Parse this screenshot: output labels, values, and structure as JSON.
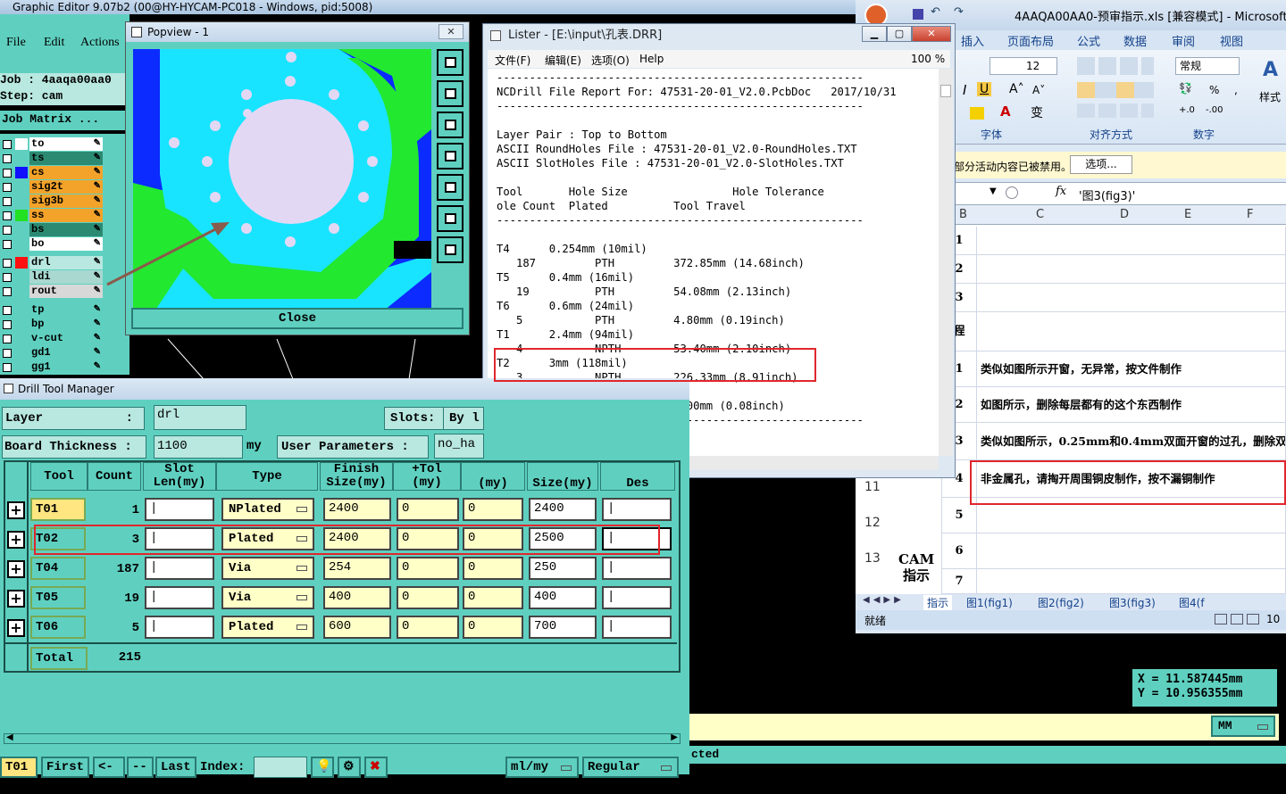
{
  "genesis": {
    "title": "Graphic Editor 9.07b2 (00@HY-HYCAM-PC018 - Windows, pid:5008)",
    "menu": [
      "File",
      "Edit",
      "Actions"
    ],
    "job_label": "Job : 4aaqa00aa0",
    "step_label": "Step: cam",
    "job_matrix": "Job Matrix ...",
    "layers": [
      {
        "name": "to",
        "color": "#ffffff",
        "row_bg": "#ffffff"
      },
      {
        "name": "ts",
        "color": "#5fd0c0",
        "row_bg": "#2c8a72"
      },
      {
        "name": "cs",
        "color": "#1010ff",
        "row_bg": "#f4a32a"
      },
      {
        "name": "sig2t",
        "color": "#5fd0c0",
        "row_bg": "#f4a32a"
      },
      {
        "name": "sig3b",
        "color": "#5fd0c0",
        "row_bg": "#f4a32a"
      },
      {
        "name": "ss",
        "color": "#22e022",
        "row_bg": "#f4a32a"
      },
      {
        "name": "bs",
        "color": "#5fd0c0",
        "row_bg": "#2c8a72"
      },
      {
        "name": "bo",
        "color": "#5fd0c0",
        "row_bg": "#ffffff"
      },
      {
        "name": "drl",
        "color": "#ff1010",
        "row_bg": "#b8e8e0"
      },
      {
        "name": "ldi",
        "color": "#5fd0c0",
        "row_bg": "#a8d8d0"
      },
      {
        "name": "rout",
        "color": "#5fd0c0",
        "row_bg": "#d8d8d8"
      },
      {
        "name": "tp",
        "color": "#5fd0c0",
        "row_bg": "#5fd0c0"
      },
      {
        "name": "bp",
        "color": "#5fd0c0",
        "row_bg": "#5fd0c0"
      },
      {
        "name": "v-cut",
        "color": "#5fd0c0",
        "row_bg": "#5fd0c0"
      },
      {
        "name": "gd1",
        "color": "#5fd0c0",
        "row_bg": "#5fd0c0"
      },
      {
        "name": "gg1",
        "color": "#5fd0c0",
        "row_bg": "#5fd0c0"
      }
    ],
    "coords": {
      "x": "X = 11.587445mm",
      "y": "Y = 10.956355mm"
    },
    "units": "MM",
    "status_text": "cted"
  },
  "popview": {
    "title": "Popview - 1",
    "close_label": "Close"
  },
  "lister": {
    "title": "Lister - [E:\\input\\孔表.DRR]",
    "menu": [
      "文件(F)",
      "编辑(E)",
      "选项(O)",
      "Help"
    ],
    "zoom": "100 %",
    "report": "--------------------------------------------------------\nNCDrill File Report For: 47531-20-01_V2.0.PcbDoc   2017/10/31\n--------------------------------------------------------\n\nLayer Pair : Top to Bottom\nASCII RoundHoles File : 47531-20-01_V2.0-RoundHoles.TXT\nASCII SlotHoles File : 47531-20-01_V2.0-SlotHoles.TXT\n\nTool       Hole Size                Hole Tolerance\nole Count  Plated          Tool Travel\n--------------------------------------------------------\n\nT4      0.254mm (10mil)\n   187         PTH         372.85mm (14.68inch)\nT5      0.4mm (16mil)\n   19          PTH         54.08mm (2.13inch)\nT6      0.6mm (24mil)\n   5           PTH         4.80mm (0.19inch)\nT1      2.4mm (94mil)\n   4           NPTH        53.40mm (2.10inch)\nT2      3mm (118mil)\n   3           NPTH        226.33mm (8.91inch)\nT3      3mm (118mil)\n   1           NPTH        2.00mm (0.08inch)\n--------------------------------------------------------"
  },
  "excel": {
    "title": "4AAQA00AA0-预审指示.xls [兼容模式] - Microsoft Excel",
    "tabs": [
      "插入",
      "页面布局",
      "公式",
      "数据",
      "审阅",
      "视图"
    ],
    "font_size": "12",
    "number_format": "常规",
    "style_label": "样式",
    "group_labels": [
      "字体",
      "对齐方式",
      "数字"
    ],
    "message": "部分活动内容已被禁用。",
    "options_button": "选项...",
    "formula": "'图3(fig3)'",
    "columns": [
      "B",
      "C",
      "D",
      "E",
      "F"
    ],
    "rows": [
      {
        "row": "1",
        "num": "1",
        "text": ""
      },
      {
        "row": "2",
        "num": "2",
        "text": ""
      },
      {
        "row": "3",
        "num": "3",
        "text": ""
      },
      {
        "row": "",
        "num": "程",
        "text": ""
      },
      {
        "row": "",
        "num": "1",
        "text": "类似如图所示开窗，无异常，按文件制作"
      },
      {
        "row": "",
        "num": "2",
        "text": "如图所示，删除每层都有的这个东西制作"
      },
      {
        "row": "",
        "num": "3",
        "text": "类似如图所示，0.25mm和0.4mm双面开窗的过孔，删除双"
      },
      {
        "row": "11",
        "num": "4",
        "text": "非金属孔，请掏开周围铜皮制作，按不漏铜制作"
      },
      {
        "row": "12",
        "num": "5",
        "text": ""
      },
      {
        "row": "13",
        "num": "6",
        "text": ""
      },
      {
        "row": "",
        "num": "7",
        "text": ""
      }
    ],
    "cam_label": "CAM\n指示",
    "sheets": [
      "指示",
      "图1(fig1)",
      "图2(fig2)",
      "图3(fig3)",
      "图4(f"
    ],
    "status": "就绪",
    "zoom": "10"
  },
  "dtm": {
    "title": "Drill Tool Manager",
    "layer_label": "Layer",
    "layer_value": "drl",
    "slots_label": "Slots:",
    "slots_value": "By l",
    "thickness_label": "Board Thickness :",
    "thickness_value": "1100",
    "thickness_unit": "my",
    "user_params_label": "User Parameters :",
    "user_params_value": "no_ha",
    "headers": [
      "Tool",
      "Count",
      "Slot\nLen(my)",
      "Type",
      "Finish\nSize(my)",
      "+Tol\n(my)",
      "(my)",
      "Size(my)",
      "Des"
    ],
    "rows": [
      {
        "tool": "T01",
        "count": "1",
        "type": "NPlated",
        "finish": "2400",
        "ptol": "0",
        "ntol": "0",
        "size": "2400",
        "highlight": true
      },
      {
        "tool": "T02",
        "count": "3",
        "type": "Plated",
        "finish": "2400",
        "ptol": "0",
        "ntol": "0",
        "size": "2500",
        "highlight": false
      },
      {
        "tool": "T04",
        "count": "187",
        "type": "Via",
        "finish": "254",
        "ptol": "0",
        "ntol": "0",
        "size": "250",
        "highlight": false
      },
      {
        "tool": "T05",
        "count": "19",
        "type": "Via",
        "finish": "400",
        "ptol": "0",
        "ntol": "0",
        "size": "400",
        "highlight": false
      },
      {
        "tool": "T06",
        "count": "5",
        "type": "Plated",
        "finish": "600",
        "ptol": "0",
        "ntol": "0",
        "size": "700",
        "highlight": false
      }
    ],
    "total_label": "Total",
    "total_value": "215",
    "nav": {
      "tool": "T01",
      "first": "First",
      "prev": "<--",
      "next": "-->",
      "last": "Last",
      "index": "Index:",
      "units": "ml/my",
      "mode": "Regular"
    }
  }
}
